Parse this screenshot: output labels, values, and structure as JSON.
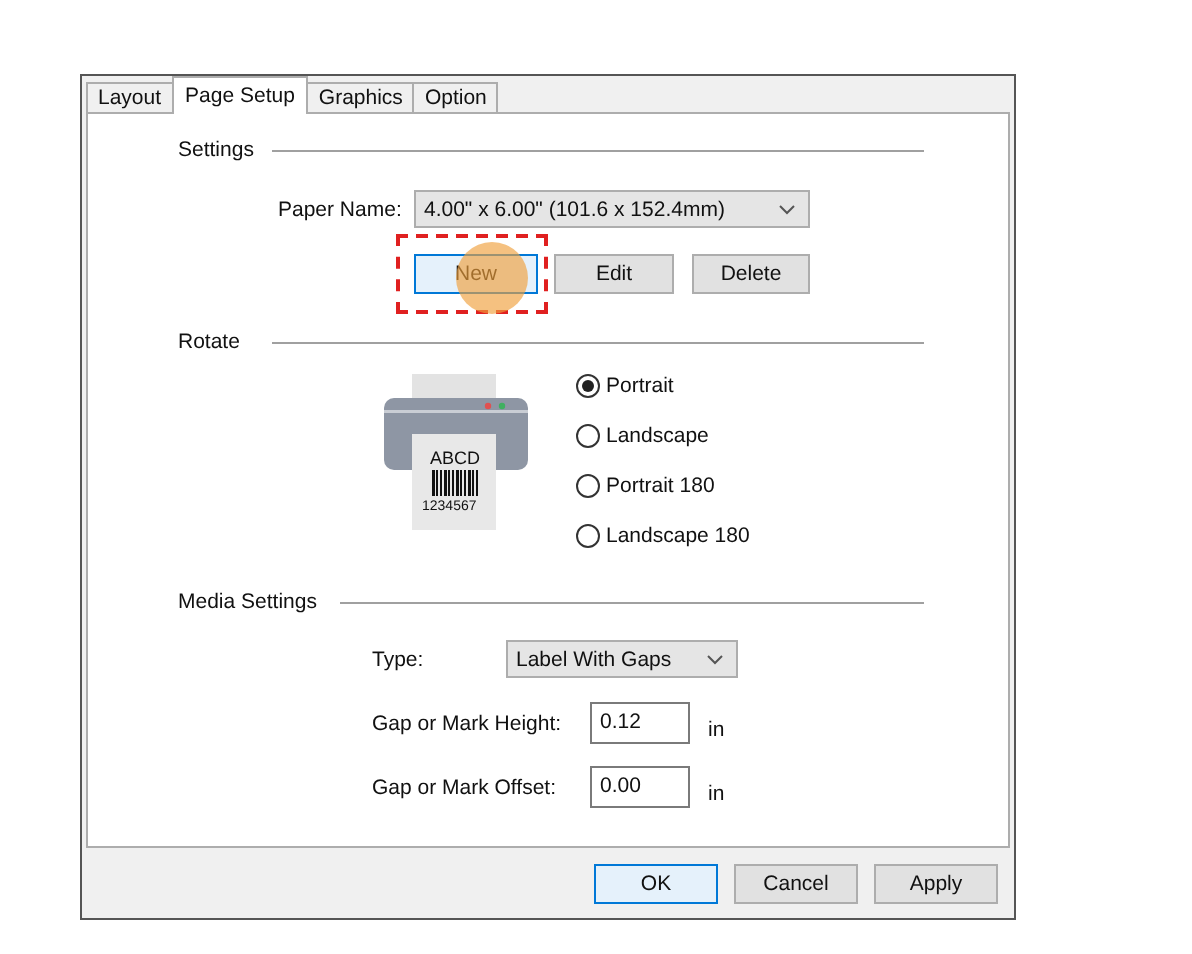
{
  "tabs": [
    {
      "label": "Layout",
      "selected": false
    },
    {
      "label": "Page Setup",
      "selected": true
    },
    {
      "label": "Graphics",
      "selected": false
    },
    {
      "label": "Option",
      "selected": false
    }
  ],
  "settings": {
    "heading": "Settings",
    "paper_name_label": "Paper Name:",
    "paper_name_value": "4.00\" x 6.00\" (101.6 x 152.4mm)",
    "buttons": [
      {
        "label": "New",
        "highlighted": true
      },
      {
        "label": "Edit",
        "highlighted": false
      },
      {
        "label": "Delete",
        "highlighted": false
      }
    ]
  },
  "rotate": {
    "heading": "Rotate",
    "printer_label_text": "ABCD",
    "printer_barcode_number": "1234567",
    "options": [
      {
        "label": "Portrait",
        "selected": true
      },
      {
        "label": "Landscape",
        "selected": false
      },
      {
        "label": "Portrait 180",
        "selected": false
      },
      {
        "label": "Landscape 180",
        "selected": false
      }
    ]
  },
  "media_settings": {
    "heading": "Media Settings",
    "type_label": "Type:",
    "type_value": "Label With Gaps",
    "fields": [
      {
        "label": "Gap or Mark Height:",
        "value": "0.12",
        "unit": "in"
      },
      {
        "label": "Gap or Mark Offset:",
        "value": "0.00",
        "unit": "in"
      }
    ]
  },
  "footer_buttons": [
    {
      "label": "OK",
      "default": true
    },
    {
      "label": "Cancel",
      "default": false
    },
    {
      "label": "Apply",
      "default": false
    }
  ]
}
